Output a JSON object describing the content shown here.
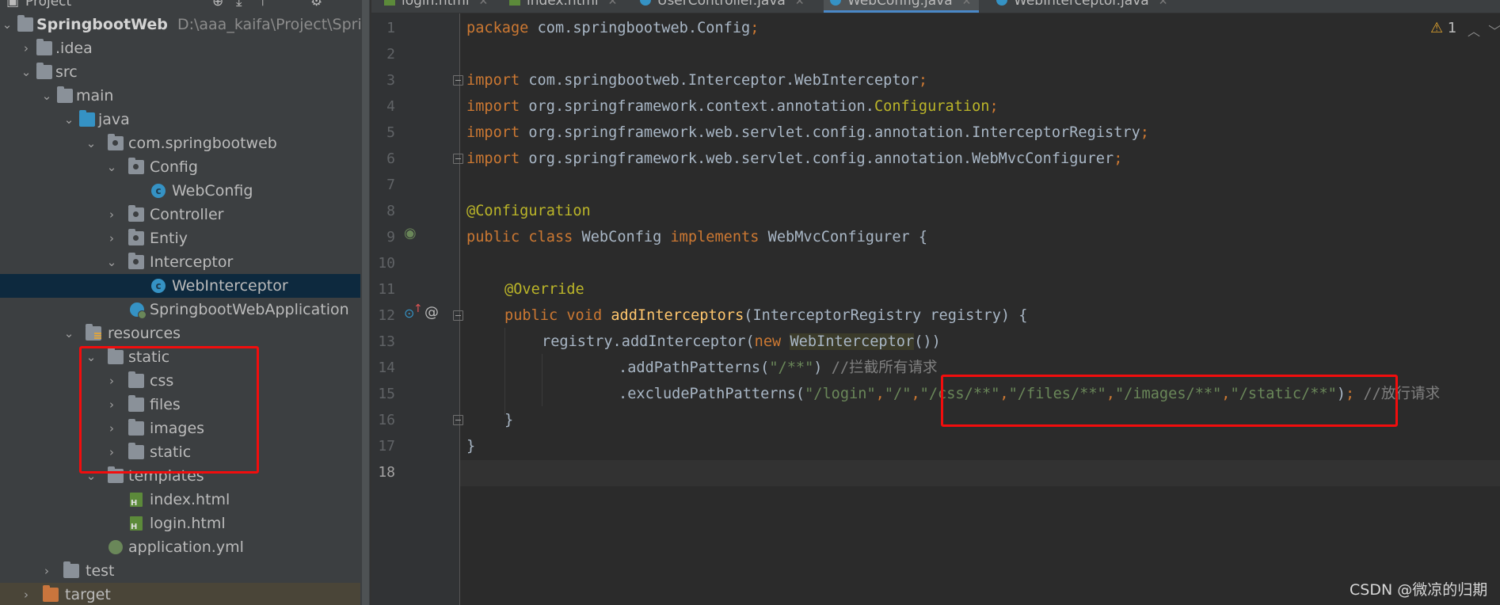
{
  "project_panel": {
    "header_title": "Project",
    "tree": [
      {
        "label": "SpringbootWeb",
        "path": "D:\\aaa_kaifa\\Project\\Springbo",
        "icon": "module-folder-icon",
        "expanded": true
      },
      {
        "label": ".idea",
        "icon": "folder-icon",
        "expanded": false
      },
      {
        "label": "src",
        "icon": "folder-icon",
        "expanded": true
      },
      {
        "label": "main",
        "icon": "folder-icon",
        "expanded": true
      },
      {
        "label": "java",
        "icon": "source-folder-icon",
        "expanded": true
      },
      {
        "label": "com.springbootweb",
        "icon": "package-icon",
        "expanded": true
      },
      {
        "label": "Config",
        "icon": "package-icon",
        "expanded": true
      },
      {
        "label": "WebConfig",
        "icon": "class-icon"
      },
      {
        "label": "Controller",
        "icon": "package-icon",
        "expanded": false
      },
      {
        "label": "Entiy",
        "icon": "package-icon",
        "expanded": false
      },
      {
        "label": "Interceptor",
        "icon": "package-icon",
        "expanded": true
      },
      {
        "label": "WebInterceptor",
        "icon": "class-icon",
        "selected": true
      },
      {
        "label": "SpringbootWebApplication",
        "icon": "spring-boot-class-icon"
      },
      {
        "label": "resources",
        "icon": "resources-folder-icon",
        "expanded": true
      },
      {
        "label": "static",
        "icon": "folder-icon",
        "expanded": true
      },
      {
        "label": "css",
        "icon": "folder-icon",
        "expanded": false
      },
      {
        "label": "files",
        "icon": "folder-icon",
        "expanded": false
      },
      {
        "label": "images",
        "icon": "folder-icon",
        "expanded": false
      },
      {
        "label": "static",
        "icon": "folder-icon",
        "expanded": false
      },
      {
        "label": "templates",
        "icon": "folder-icon",
        "expanded": true
      },
      {
        "label": "index.html",
        "icon": "html-file-icon"
      },
      {
        "label": "login.html",
        "icon": "html-file-icon"
      },
      {
        "label": "application.yml",
        "icon": "yaml-file-icon"
      },
      {
        "label": "test",
        "icon": "folder-icon",
        "expanded": false
      },
      {
        "label": "target",
        "icon": "excluded-folder-icon",
        "expanded": false
      }
    ]
  },
  "tabs": [
    {
      "label": "login.html",
      "icon": "html-file-icon"
    },
    {
      "label": "index.html",
      "icon": "html-file-icon"
    },
    {
      "label": "UserController.java",
      "icon": "java-class-icon"
    },
    {
      "label": "WebConfig.java",
      "icon": "java-class-icon",
      "active": true
    },
    {
      "label": "WebInterceptor.java",
      "icon": "java-class-icon"
    }
  ],
  "editor": {
    "warning_count": "1",
    "line_numbers": [
      "1",
      "2",
      "3",
      "4",
      "5",
      "6",
      "7",
      "8",
      "9",
      "10",
      "11",
      "12",
      "13",
      "14",
      "15",
      "16",
      "17",
      "18"
    ],
    "current_line": "18",
    "code": {
      "l1_kw": "package",
      "l1_rest": " com.springbootweb.Config",
      "l3_kw": "import",
      "l3_rest": " com.springbootweb.Interceptor.WebInterceptor",
      "l4_kw": "import",
      "l4_rest": " org.springframework.context.annotation.",
      "l4_cls": "Configuration",
      "l5_kw": "import",
      "l5_rest": " org.springframework.web.servlet.config.annotation.InterceptorRegistry",
      "l6_kw": "import",
      "l6_rest": " org.springframework.web.servlet.config.annotation.WebMvcConfigurer",
      "semicolon": ";",
      "l8_ann": "@Configuration",
      "l9_kw1": "public class",
      "l9_name": " WebConfig ",
      "l9_kw2": "implements",
      "l9_rest": " WebMvcConfigurer {",
      "l11_ann": "@Override",
      "l12_kw": "public void",
      "l12_fn": "addInterceptors",
      "l12_rest": "(InterceptorRegistry registry) {",
      "l13_a": "registry.addInterceptor(",
      "l13_kw": "new",
      "l13_cls": "WebInterceptor",
      "l13_b": "())",
      "l14_a": ".addPathPatterns(",
      "l14_str": "\"/**\"",
      "l14_b": ") ",
      "l14_cm": "//拦截所有请求",
      "l15_a": ".excludePathPatterns(",
      "l15_s1": "\"/login\"",
      "l15_s2": "\"/\"",
      "l15_s3": "\"/css/**\"",
      "l15_s4": "\"/files/**\"",
      "l15_s5": "\"/images/**\"",
      "l15_s6": "\"/static/**\"",
      "l15_b": ")",
      "l15_cm": "//放行请求",
      "comma": ",",
      "l16": "}",
      "l17": "}"
    }
  },
  "watermark": "CSDN @微凉的归期",
  "colors": {
    "annotation_box": "#f20d0d",
    "keyword": "#cc7832",
    "string": "#6a8759",
    "annotation": "#bbb529"
  }
}
